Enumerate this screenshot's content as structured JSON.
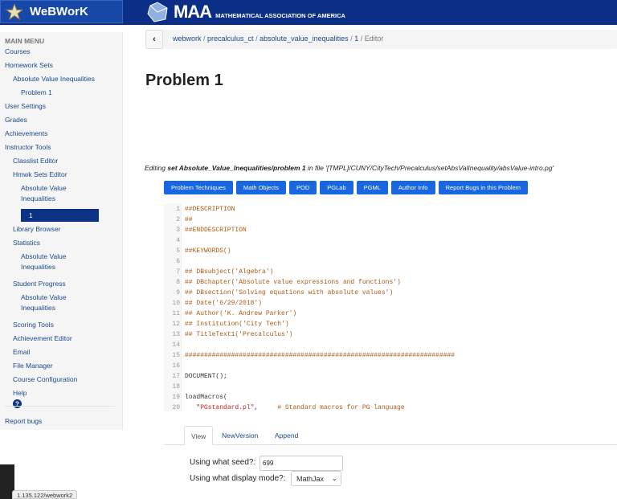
{
  "header": {
    "brand": "WeBWorK",
    "maa_big": "MAA",
    "maa_small": "MATHEMATICAL ASSOCIATION OF AMERICA"
  },
  "sidebar": {
    "heading": "MAIN MENU",
    "items": [
      {
        "label": "Courses",
        "level": 0
      },
      {
        "label": "Homework Sets",
        "level": 0
      },
      {
        "label": "Absolute Value Inequalities",
        "level": 1
      },
      {
        "label": "Problem 1",
        "level": 2
      },
      {
        "label": "User Settings",
        "level": 0
      },
      {
        "label": "Grades",
        "level": 0
      },
      {
        "label": "Achievements",
        "level": 0
      },
      {
        "label": "Instructor Tools",
        "level": 0
      },
      {
        "label": "Classlist Editor",
        "level": 1
      },
      {
        "label": "Hmwk Sets Editor",
        "level": 1
      },
      {
        "label": "Absolute Value",
        "level": 2
      },
      {
        "label": "Inequalities",
        "level": 2
      },
      {
        "label": "1",
        "level": 2,
        "active": true
      },
      {
        "label": "Library Browser",
        "level": 1
      },
      {
        "label": "Statistics",
        "level": 1
      },
      {
        "label": "Absolute Value",
        "level": 2
      },
      {
        "label": "Inequalities",
        "level": 2
      },
      {
        "label": "Student Progress",
        "level": 1
      },
      {
        "label": "Absolute Value",
        "level": 2
      },
      {
        "label": "Inequalities",
        "level": 2
      },
      {
        "label": "Scoring Tools",
        "level": 1
      },
      {
        "label": "Achievement Editor",
        "level": 1
      },
      {
        "label": "Email",
        "level": 1
      },
      {
        "label": "File Manager",
        "level": 1
      },
      {
        "label": "Course Configuration",
        "level": 1
      },
      {
        "label": "Help",
        "level": 1
      }
    ],
    "report_bugs": "Report bugs"
  },
  "breadcrumb": {
    "items": [
      "webwork",
      "precalculus_ct",
      "absolute_value_inequalities",
      "1"
    ],
    "current": "Editor"
  },
  "page_title": "Problem 1",
  "editing": {
    "prefix": "Editing",
    "set": "set Absolute_Value_Inequalities/problem 1",
    "mid": "in file",
    "file": "'[TMPL]/CUNY/CityTech/Precalculus/setAbsValInequality/absValue-intro.pg'"
  },
  "buttons": [
    "Problem Techniques",
    "Math Objects",
    "POD",
    "PGLab",
    "PGML",
    "Author Info",
    "Report Bugs in this Problem"
  ],
  "code": [
    [
      [
        "cm",
        "##DESCRIPTION"
      ]
    ],
    [
      [
        "cm",
        "##"
      ]
    ],
    [
      [
        "cm",
        "##ENDDESCRIPTION"
      ]
    ],
    [],
    [
      [
        "cm",
        "##KEYWORDS()"
      ]
    ],
    [],
    [
      [
        "cm",
        "## DBsubject('Algebra')"
      ]
    ],
    [
      [
        "cm",
        "## DBchapter('Absolute value expressions and functions')"
      ]
    ],
    [
      [
        "cm",
        "## DBsection('Solving equations with absolute values')"
      ]
    ],
    [
      [
        "cm",
        "## Date('6/29/2018')"
      ]
    ],
    [
      [
        "cm",
        "## Author('K. Andrew Parker')"
      ]
    ],
    [
      [
        "cm",
        "## Institution('City Tech')"
      ]
    ],
    [
      [
        "cm",
        "## TitleText1('Precalculus')"
      ]
    ],
    [],
    [
      [
        "cm",
        "######################################################################"
      ]
    ],
    [],
    [
      [
        "pl",
        "DOCUMENT();"
      ]
    ],
    [],
    [
      [
        "pl",
        "loadMacros("
      ]
    ],
    [
      [
        "pl",
        "   "
      ],
      [
        "st",
        "\"PGstandard.pl\""
      ],
      [
        "pl",
        ",     "
      ],
      [
        "cm",
        "# Standard macros for PG language"
      ]
    ]
  ],
  "tabs": [
    "View",
    "NewVersion",
    "Append"
  ],
  "form": {
    "seed_label": "Using what seed?:",
    "seed_value": "699",
    "mode_label": "Using what display mode?:",
    "mode_value": "MathJax"
  },
  "status_url": "1.135.122/webwork2"
}
